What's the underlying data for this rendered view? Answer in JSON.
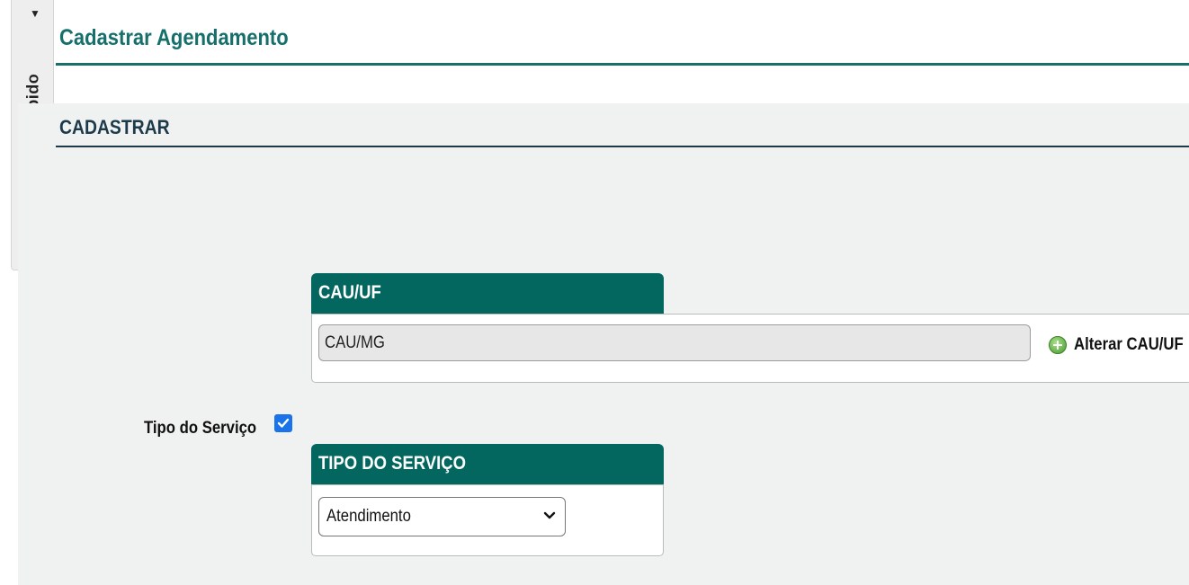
{
  "side_tab": {
    "label": "Acesso Rápido"
  },
  "header": {
    "title": "Cadastrar Agendamento"
  },
  "section": {
    "title": "CADASTRAR"
  },
  "cau_panel": {
    "legend": "CAU/UF",
    "value": "CAU/MG",
    "alter_label": "Alterar CAU/UF"
  },
  "tipo_servico": {
    "label": "Tipo do Serviço",
    "checked": true,
    "legend": "TIPO DO SERVIÇO",
    "selected": "Atendimento"
  },
  "colors": {
    "accent": "#03665f",
    "title": "#176f6c",
    "section": "#1c3a4a",
    "checkbox": "#1a73e8"
  },
  "icons": [
    "chevron-down-icon",
    "lightning-icon",
    "plus-circle-icon",
    "checkmark-icon"
  ]
}
